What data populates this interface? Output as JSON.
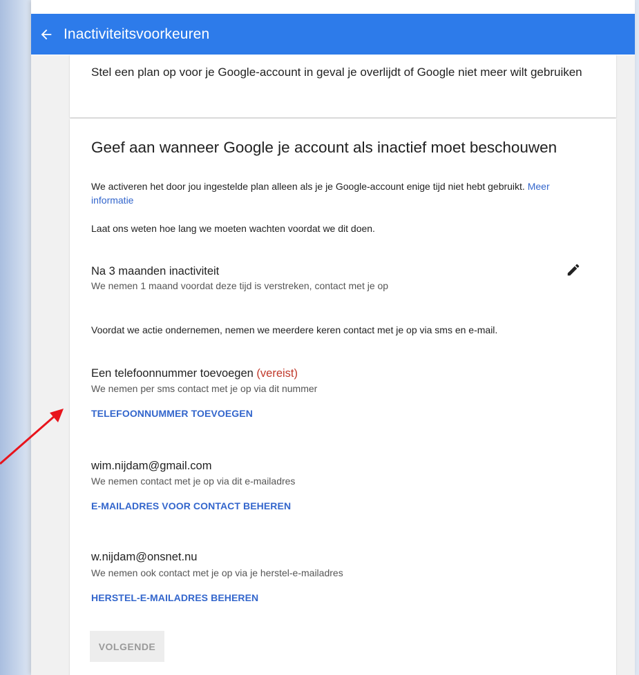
{
  "header": {
    "title": "Inactiviteitsvoorkeuren"
  },
  "intro": {
    "text": "Stel een plan op voor je Google-account in geval je overlijdt of Google niet meer wilt gebruiken"
  },
  "section": {
    "heading": "Geef aan wanneer Google je account als inactief moet beschouwen",
    "description": "We activeren het door jou ingestelde plan alleen als je je Google-account enige tijd niet hebt gebruikt.",
    "more_info_link": "Meer informatie",
    "wait_text": "Laat ons weten hoe lang we moeten wachten voordat we dit doen.",
    "period_title": "Na 3 maanden inactiviteit",
    "period_sub": "We nemen 1 maand voordat deze tijd is verstreken, contact met je op",
    "contact_note": "Voordat we actie ondernemen, nemen we meerdere keren contact met je op via sms en e-mail."
  },
  "phone": {
    "title": "Een telefoonnummer toevoegen",
    "required": "(vereist)",
    "sub": "We nemen per sms contact met je op via dit nummer",
    "action": "TELEFOONNUMMER TOEVOEGEN"
  },
  "email": {
    "address": "wim.nijdam@gmail.com",
    "sub": "We nemen contact met je op via dit e-mailadres",
    "action": "E-MAILADRES VOOR CONTACT BEHEREN"
  },
  "recovery": {
    "address": "w.nijdam@onsnet.nu",
    "sub": "We nemen ook contact met je op via je herstel-e-mailadres",
    "action": "HERSTEL-E-MAILADRES BEHEREN"
  },
  "footer": {
    "next_label": "VOLGENDE"
  },
  "colors": {
    "header_bg": "#2d7bea",
    "link": "#3366cc",
    "required": "#c0392b",
    "annotation_arrow": "#e8141c"
  },
  "icons": {
    "back": "arrow-left-icon",
    "edit": "pencil-icon"
  }
}
